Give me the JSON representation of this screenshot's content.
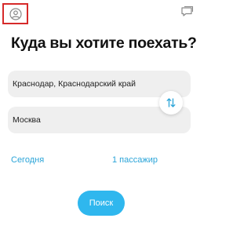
{
  "header": {
    "profile_icon": "user-icon",
    "chat_icon": "chat-bubble-icon"
  },
  "title": "Куда вы хотите поехать?",
  "route": {
    "from_value": "Краснодар, Краснодарский край",
    "to_value": "Москва",
    "swap_icon": "swap-arrows-icon"
  },
  "options": {
    "date_label": "Сегодня",
    "passengers_label": "1 пассажир"
  },
  "search_button_label": "Поиск",
  "colors": {
    "accent": "#2fb7ee",
    "link": "#2aa4d8",
    "field_bg": "#efefef",
    "highlight_border": "#d62a2a"
  }
}
